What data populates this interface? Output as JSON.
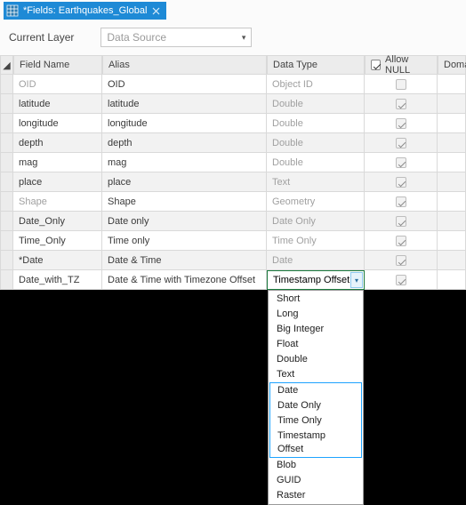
{
  "tab": {
    "title": "*Fields: Earthquakes_Global"
  },
  "layerbar": {
    "label": "Current Layer",
    "dropdown_value": "Data Source"
  },
  "columns": {
    "rowhandle": "◢",
    "field_name": "Field Name",
    "alias": "Alias",
    "data_type": "Data Type",
    "allow_null": "Allow NULL",
    "domain": "Domain"
  },
  "rows": [
    {
      "field": "OID",
      "alias": "OID",
      "type": "Object ID",
      "null_checked": false,
      "field_muted": true,
      "type_muted": true
    },
    {
      "field": "latitude",
      "alias": "latitude",
      "type": "Double",
      "null_checked": true,
      "type_muted": true
    },
    {
      "field": "longitude",
      "alias": "longitude",
      "type": "Double",
      "null_checked": true,
      "type_muted": true
    },
    {
      "field": "depth",
      "alias": "depth",
      "type": "Double",
      "null_checked": true,
      "type_muted": true
    },
    {
      "field": "mag",
      "alias": "mag",
      "type": "Double",
      "null_checked": true,
      "type_muted": true
    },
    {
      "field": "place",
      "alias": "place",
      "type": "Text",
      "null_checked": true,
      "type_muted": true
    },
    {
      "field": "Shape",
      "alias": "Shape",
      "type": "Geometry",
      "null_checked": true,
      "field_muted": true,
      "type_muted": true
    },
    {
      "field": "Date_Only",
      "alias": "Date only",
      "type": "Date Only",
      "null_checked": true,
      "type_muted": true
    },
    {
      "field": "Time_Only",
      "alias": "Time only",
      "type": "Time Only",
      "null_checked": true,
      "type_muted": true
    },
    {
      "field": "*Date",
      "alias": "Date & Time",
      "type": "Date",
      "null_checked": true,
      "type_muted": true
    },
    {
      "field": "Date_with_TZ",
      "alias": "Date & Time with Timezone Offset",
      "type": "Timestamp Offset",
      "null_checked": true,
      "editable_type": true
    }
  ],
  "popup": {
    "items_top": [
      "Short",
      "Long",
      "Big Integer",
      "Float",
      "Double",
      "Text"
    ],
    "items_hl": [
      "Date",
      "Date Only",
      "Time Only",
      "Timestamp Offset"
    ],
    "items_bot": [
      "Blob",
      "GUID",
      "Raster"
    ]
  }
}
